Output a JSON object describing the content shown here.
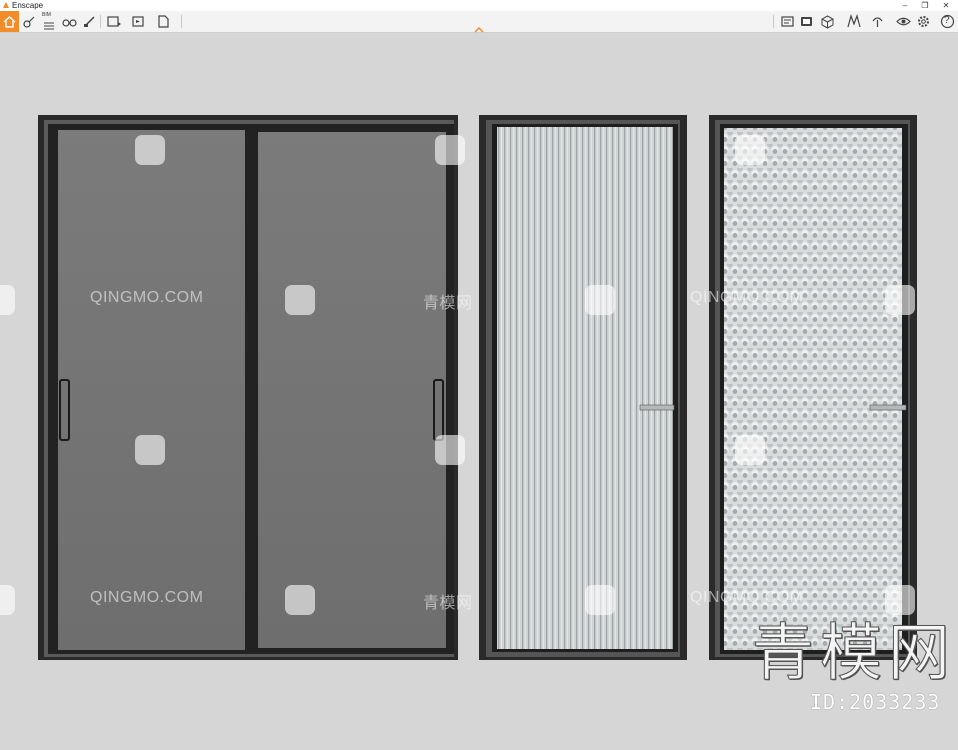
{
  "window": {
    "title": "Enscape",
    "controls": {
      "minimize": "–",
      "restore": "❐",
      "close": "✕"
    }
  },
  "toolbar": {
    "accent": "#f28b2a",
    "left_icons": [
      "home-icon",
      "asset-library-icon",
      "bim-icon",
      "views-icon",
      "binoculars-icon",
      "brush-icon",
      "export-image-icon",
      "export-video-icon",
      "export-file-icon"
    ],
    "bim_label": "BIM",
    "right_icons": [
      "info-icon",
      "panorama-icon",
      "cube-icon",
      "material-editor-icon",
      "upload-icon",
      "visual-settings-icon",
      "settings-icon",
      "help-icon"
    ],
    "help_label": "?"
  },
  "scene": {
    "doors": [
      {
        "name": "sliding-door-double",
        "glass": "gray tinted"
      },
      {
        "name": "reeded-glass-door",
        "glass": "fluted"
      },
      {
        "name": "textured-glass-door",
        "glass": "patterned"
      }
    ],
    "watermark_text": "QINGMO.COM",
    "watermark_cn": "青模网",
    "watermark_big": "青模网",
    "id_label": "ID:2033233"
  }
}
